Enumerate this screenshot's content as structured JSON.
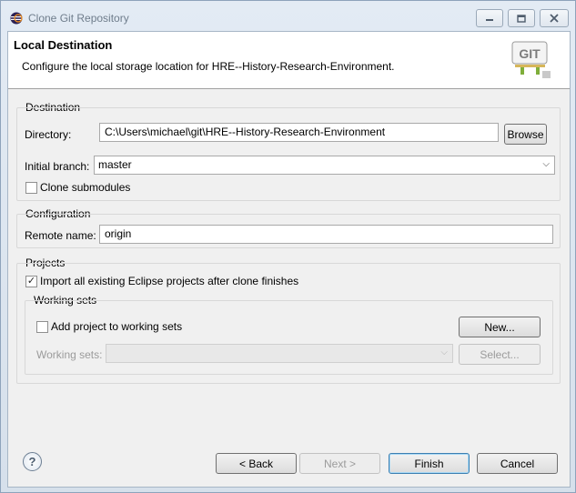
{
  "window": {
    "title": "Clone Git Repository",
    "icon": "eclipse-icon"
  },
  "caption_buttons": {
    "minimize": "minimize-icon",
    "maximize": "maximize-icon",
    "close": "close-icon"
  },
  "header": {
    "title": "Local Destination",
    "description": "Configure the local storage location for HRE--History-Research-Environment.",
    "logo_text": "GIT"
  },
  "destination": {
    "group_label": "Destination",
    "directory_label": "Directory:",
    "directory_value": "C:\\Users\\michael\\git\\HRE--History-Research-Environment",
    "browse_label": "Browse",
    "initial_branch_label": "Initial branch:",
    "initial_branch_value": "master",
    "clone_submodules_label": "Clone submodules",
    "clone_submodules_checked": false
  },
  "configuration": {
    "group_label": "Configuration",
    "remote_name_label": "Remote name:",
    "remote_name_value": "origin"
  },
  "projects": {
    "group_label": "Projects",
    "import_label": "Import all existing Eclipse projects after clone finishes",
    "import_checked": true,
    "working_sets": {
      "group_label": "Working sets",
      "add_label": "Add project to working sets",
      "add_checked": false,
      "new_label": "New...",
      "working_sets_label": "Working sets:",
      "working_sets_value": "",
      "select_label": "Select..."
    }
  },
  "footer": {
    "help": "help-icon",
    "back_label": "< Back",
    "next_label": "Next >",
    "finish_label": "Finish",
    "cancel_label": "Cancel"
  }
}
